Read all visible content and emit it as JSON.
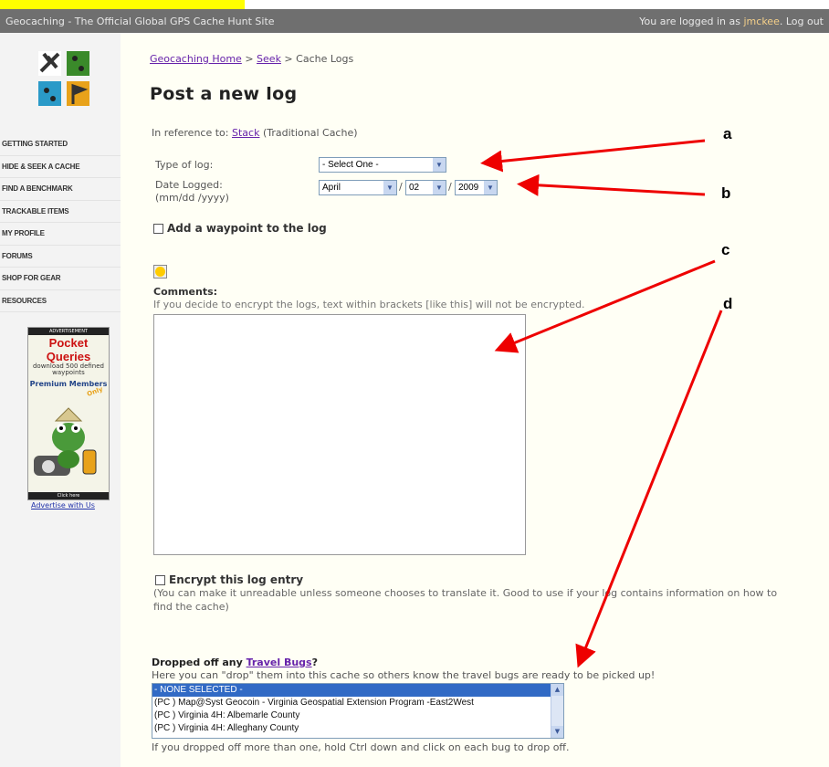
{
  "topbar": {
    "site_title": "Geocaching - The Official Global GPS Cache Hunt Site",
    "logged_in_prefix": "You are logged in as ",
    "username": "jmckee",
    "logout": ". Log out"
  },
  "sidebar": {
    "nav": [
      "GETTING STARTED",
      "HIDE & SEEK A CACHE",
      "FIND A BENCHMARK",
      "TRACKABLE ITEMS",
      "MY PROFILE",
      "FORUMS",
      "SHOP FOR GEAR",
      "RESOURCES"
    ],
    "ad": {
      "header": "ADVERTISEMENT",
      "title": "Pocket Queries",
      "subtitle": "download 500 defined waypoints",
      "premium": "Premium Members",
      "only": "Only",
      "click": "Click here"
    },
    "advertise_link": "Advertise with Us"
  },
  "breadcrumb": {
    "home": "Geocaching Home",
    "sep1": " > ",
    "seek": "Seek",
    "sep2": " > ",
    "current": "Cache Logs"
  },
  "page_title": "Post a new log",
  "reference": {
    "prefix": "In reference to: ",
    "cache_name": "Stack",
    "cache_type": " (Traditional Cache)"
  },
  "form": {
    "type_of_log_label": "Type of log:",
    "type_of_log_value": "- Select One -",
    "date_logged_label": "Date Logged: (mm/dd /yyyy)",
    "month_value": "April",
    "day_value": "02",
    "year_value": "2009",
    "add_waypoint_label": "Add a waypoint to the log",
    "comments_label": "Comments:",
    "comments_hint": "If you decide to encrypt the logs, text within brackets [like this] will not be encrypted.",
    "encrypt_label": "Encrypt this log entry",
    "encrypt_note": "(You can make it unreadable unless someone chooses to translate it. Good to use if your log contains information on how to find the cache)"
  },
  "travel_bugs": {
    "label_prefix": "Dropped off any ",
    "label_link": "Travel Bugs",
    "label_suffix": "?",
    "hint": "Here you can \"drop\" them into this cache so others know the travel bugs are ready to be picked up!",
    "options": [
      "- NONE SELECTED -",
      "(PC     ) Map@Syst Geocoin - Virginia Geospatial Extension Program -East2West",
      "(PC     ) Virginia 4H: Albemarle County",
      "(PC     ) Virginia 4H: Alleghany County"
    ],
    "footer": "If you dropped off more than one, hold Ctrl down and click on each bug to drop off."
  },
  "annotations": [
    "a",
    "b",
    "c",
    "d"
  ],
  "colors": {
    "topbar": "#6f6f6f",
    "link": "#6622aa",
    "arrow": "#ee0000",
    "selected_option": "#316ac5",
    "highlight": "#ffff00"
  }
}
